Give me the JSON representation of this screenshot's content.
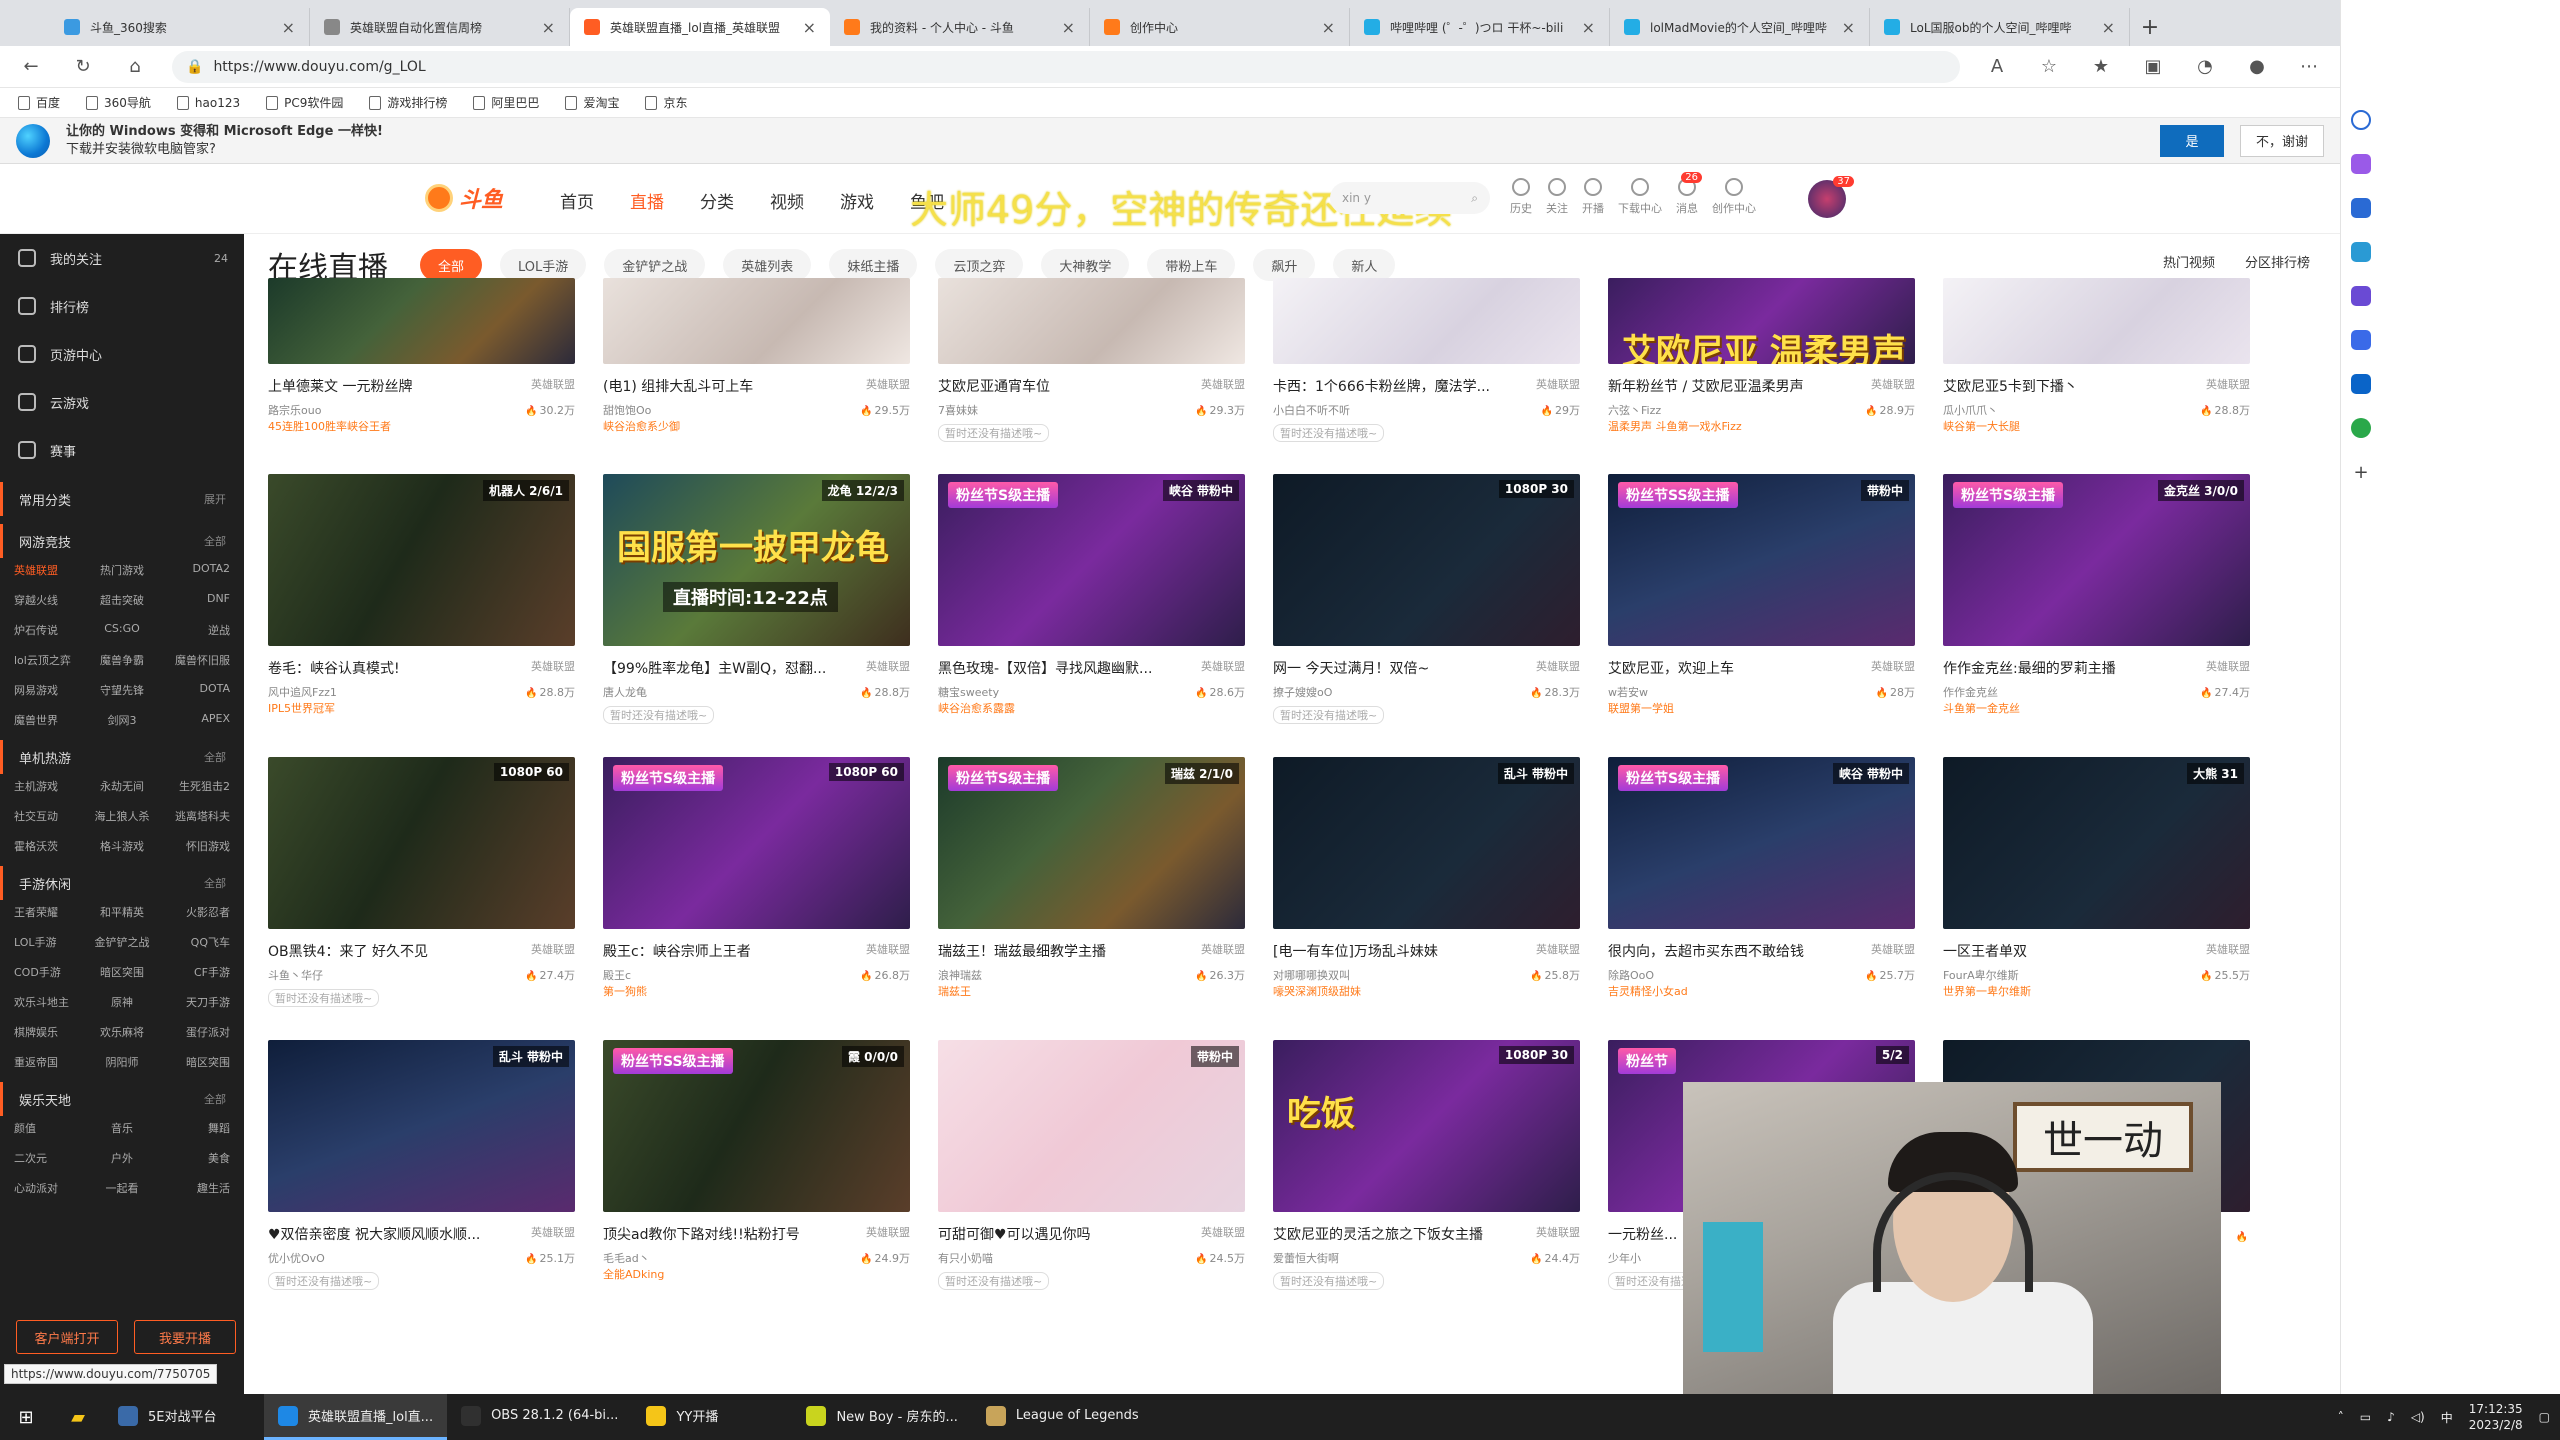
{
  "browser": {
    "tabs": [
      {
        "title": "斗鱼_360搜索",
        "color": "#3b9ae1",
        "active": false
      },
      {
        "title": "英雄联盟自动化置信周榜",
        "color": "#888888",
        "active": false
      },
      {
        "title": "英雄联盟直播_lol直播_英雄联盟",
        "color": "#ff5d23",
        "active": true
      },
      {
        "title": "我的资料 - 个人中心 - 斗鱼",
        "color": "#ff7a1a",
        "active": false
      },
      {
        "title": "创作中心",
        "color": "#ff7a1a",
        "active": false
      },
      {
        "title": "哔哩哔哩 (゜-゜)つロ 干杯~-bili",
        "color": "#23ade5",
        "active": false
      },
      {
        "title": "lolMadMovie的个人空间_哔哩哔",
        "color": "#23ade5",
        "active": false
      },
      {
        "title": "LoL国服ob的个人空间_哔哩哔",
        "color": "#23ade5",
        "active": false
      }
    ],
    "url": "https://www.douyu.com/g_LOL",
    "bookmarks": [
      "百度",
      "360导航",
      "hao123",
      "PC9软件园",
      "游戏排行榜",
      "阿里巴巴",
      "爱淘宝",
      "京东"
    ],
    "infobar": {
      "line1": "让你的 Windows 变得和 Microsoft Edge 一样快!",
      "line2": "下载并安装微软电脑管家?",
      "yes": "是",
      "no": "不，谢谢"
    }
  },
  "douyu": {
    "logo": "斗鱼",
    "nav": [
      "首页",
      "直播",
      "分类",
      "视频",
      "游戏",
      "鱼吧"
    ],
    "nav_active": "直播",
    "search_placeholder": "xin y",
    "tools": [
      {
        "label": "历史"
      },
      {
        "label": "关注"
      },
      {
        "label": "开播"
      },
      {
        "label": "下载中心"
      },
      {
        "label": "消息",
        "badge": "26"
      },
      {
        "label": "创作中心"
      }
    ],
    "avatar_badge": "37",
    "overlay_text": "大师49分，空神的传奇还在延续",
    "page_heading": "在线直播",
    "filters": [
      "全部",
      "LOL手游",
      "金铲铲之战",
      "英雄列表",
      "妹纸主播",
      "云顶之弈",
      "大神教学",
      "带粉上车",
      "飙升",
      "新人"
    ],
    "filters_right": [
      "热门视频",
      "分区排行榜"
    ],
    "sidebar": {
      "top": [
        "我的关注",
        "排行榜",
        "页游中心",
        "云游戏",
        "赛事"
      ],
      "follow_count": "24",
      "common": "常用分类",
      "common_expand": "展开",
      "sections": [
        {
          "title": "网游竞技",
          "items": [
            "英雄联盟",
            "热门游戏",
            "DOTA2",
            "穿越火线",
            "超击突破",
            "DNF",
            "炉石传说",
            "CS:GO",
            "逆战",
            "lol云顶之弈",
            "魔兽争霸",
            "魔兽怀旧服",
            "网易游戏",
            "守望先锋",
            "DOTA",
            "魔兽世界",
            "剑网3",
            "APEX"
          ]
        },
        {
          "title": "单机热游",
          "items": [
            "主机游戏",
            "永劫无间",
            "生死狙击2",
            "社交互动",
            "海上狼人杀",
            "逃离塔科夫",
            "霍格沃茨",
            "格斗游戏",
            "怀旧游戏"
          ]
        },
        {
          "title": "手游休闲",
          "items": [
            "王者荣耀",
            "和平精英",
            "火影忍者",
            "LOL手游",
            "金铲铲之战",
            "QQ飞车",
            "COD手游",
            "暗区突围",
            "CF手游",
            "欢乐斗地主",
            "原神",
            "天刀手游",
            "棋牌娱乐",
            "欢乐麻将",
            "蛋仔派对",
            "重返帝国",
            "阴阳师",
            "暗区突围"
          ]
        },
        {
          "title": "娱乐天地",
          "items": [
            "颜值",
            "音乐",
            "舞蹈",
            "二次元",
            "户外",
            "美食",
            "心动派对",
            "一起看",
            "趣生活"
          ]
        }
      ],
      "all_label": "全部",
      "bottom": [
        "客户端打开",
        "我要开播"
      ]
    },
    "cards": [
      {
        "title": "上单德莱文 一元粉丝牌",
        "cat": "英雄联盟",
        "anchor": "路宗乐ouo",
        "hot": "30.2万",
        "tag": "45连胜100胜率峡谷王者",
        "bg": "bg-game1"
      },
      {
        "title": "(电1) 组排大乱斗可上车",
        "cat": "英雄联盟",
        "anchor": "甜饱饱Oo",
        "hot": "29.5万",
        "tag": "峡谷治愈系少御",
        "bg": "bg-girl1"
      },
      {
        "title": "艾欧尼亚通宵车位",
        "cat": "英雄联盟",
        "anchor": "7喜妹妹",
        "hot": "29.3万",
        "tag": "暂时还没有描述哦~",
        "gray": true,
        "bg": "bg-girl1"
      },
      {
        "title": "卡西：1个666卡粉丝牌，魔法学...",
        "cat": "英雄联盟",
        "anchor": "小白白不听不听",
        "hot": "29万",
        "tag": "暂时还没有描述哦~",
        "gray": true,
        "bg": "bg-girl2"
      },
      {
        "title": "新年粉丝节 / 艾欧尼亚温柔男声",
        "cat": "英雄联盟",
        "anchor": "六弦丶Fizz",
        "hot": "28.9万",
        "tag": "温柔男声 斗鱼第一戏水Fizz",
        "bg": "bg-purple",
        "banner": "艾欧尼亚 温柔男声"
      },
      {
        "title": "艾欧尼亚5卡到下播丶",
        "cat": "英雄联盟",
        "anchor": "瓜小爪爪丶",
        "hot": "28.8万",
        "tag": "峡谷第一大长腿",
        "bg": "bg-girl2"
      },
      {
        "title": "卷毛：峡谷认真模式!",
        "cat": "英雄联盟",
        "anchor": "风中追风Fzz1",
        "hot": "28.8万",
        "tag": "IPL5世界冠军",
        "bg": "bg-game3",
        "corner": "机器人 2/6/1"
      },
      {
        "title": "【99%胜率龙龟】主W副Q，怼翻...",
        "cat": "英雄联盟",
        "anchor": "唐人龙龟",
        "hot": "28.8万",
        "tag": "暂时还没有描述哦~",
        "gray": true,
        "bg": "bg-dragon",
        "corner": "龙龟 12/2/3",
        "banner": "国服第一披甲龙龟",
        "sub": "直播时间:12-22点"
      },
      {
        "title": "黑色玫瑰-【双倍】寻找风趣幽默...",
        "cat": "英雄联盟",
        "anchor": "糖宝sweety",
        "hot": "28.6万",
        "tag": "峡谷治愈系露露",
        "bg": "bg-purple",
        "corner": "峡谷 带粉中",
        "fan": "粉丝节S级主播"
      },
      {
        "title": "网一 今天过满月！双倍~",
        "cat": "英雄联盟",
        "anchor": "撩子嫂嫂oO",
        "hot": "28.3万",
        "tag": "暂时还没有描述哦~",
        "gray": true,
        "bg": "bg-dark",
        "corner": "1080P 30"
      },
      {
        "title": "艾欧尼亚，欢迎上车",
        "cat": "英雄联盟",
        "anchor": "w若安w",
        "hot": "28万",
        "tag": "联盟第一学姐",
        "bg": "bg-game2",
        "corner": "带粉中",
        "fan": "粉丝节SS级主播"
      },
      {
        "title": "作作金克丝:最细的罗莉主播",
        "cat": "英雄联盟",
        "anchor": "作作金克丝",
        "hot": "27.4万",
        "tag": "斗鱼第一金克丝",
        "bg": "bg-purple",
        "corner": "金克丝 3/0/0",
        "fan": "粉丝节S级主播"
      },
      {
        "title": "OB黑铁4：来了 好久不见",
        "cat": "英雄联盟",
        "anchor": "斗鱼丶华仔",
        "hot": "27.4万",
        "tag": "暂时还没有描述哦~",
        "gray": true,
        "bg": "bg-game3",
        "corner": "1080P 60"
      },
      {
        "title": "殿王c：峡谷宗师上王者",
        "cat": "英雄联盟",
        "anchor": "殿王c",
        "hot": "26.8万",
        "tag": "第一狗熊",
        "bg": "bg-purple",
        "corner": "1080P 60",
        "fan": "粉丝节S级主播"
      },
      {
        "title": "瑞兹王！瑞兹最细教学主播",
        "cat": "英雄联盟",
        "anchor": "浪神瑞兹",
        "hot": "26.3万",
        "tag": "瑞兹王",
        "bg": "bg-game1",
        "corner": "瑞兹 2/1/0",
        "fan": "粉丝节S级主播"
      },
      {
        "title": "[电一有车位]万场乱斗妹妹",
        "cat": "英雄联盟",
        "anchor": "对哪哪哪换双叫",
        "hot": "25.8万",
        "tag": "嚎哭深渊顶级甜妹",
        "bg": "bg-dark",
        "corner": "乱斗 带粉中"
      },
      {
        "title": "很内向，去超市买东西不敢给钱",
        "cat": "英雄联盟",
        "anchor": "除路OoO",
        "hot": "25.7万",
        "tag": "吉灵精怪小女ad",
        "bg": "bg-game2",
        "corner": "峡谷 带粉中",
        "fan": "粉丝节S级主播"
      },
      {
        "title": "一区王者单双",
        "cat": "英雄联盟",
        "anchor": "FourA卑尔维斯",
        "hot": "25.5万",
        "tag": "世界第一卑尔维斯",
        "bg": "bg-dark",
        "corner": "大熊 31"
      },
      {
        "title": "♥双倍亲密度 祝大家顺风顺水顺...",
        "cat": "英雄联盟",
        "anchor": "优小优OvO",
        "hot": "25.1万",
        "tag": "暂时还没有描述哦~",
        "gray": true,
        "bg": "bg-game2",
        "corner": "乱斗 带粉中"
      },
      {
        "title": "顶尖ad教你下路对线!!粘粉打号",
        "cat": "英雄联盟",
        "anchor": "毛毛ad丶",
        "hot": "24.9万",
        "tag": "全能ADking",
        "bg": "bg-game3",
        "corner": "霞 0/0/0",
        "fan": "粉丝节SS级主播"
      },
      {
        "title": "可甜可御♥可以遇见你吗",
        "cat": "英雄联盟",
        "anchor": "有只小奶喵",
        "hot": "24.5万",
        "tag": "暂时还没有描述哦~",
        "gray": true,
        "bg": "bg-pink",
        "corner": "带粉中"
      },
      {
        "title": "艾欧尼亚的灵活之旅之下饭女主播",
        "cat": "英雄联盟",
        "anchor": "爱蕾恒大街啊",
        "hot": "24.4万",
        "tag": "暂时还没有描述哦~",
        "gray": true,
        "bg": "bg-purple",
        "corner": "1080P 30",
        "banner": "吃饭"
      },
      {
        "title": "一元粉丝...",
        "cat": "英雄联盟",
        "anchor": "少年小",
        "hot": "24万",
        "tag": "暂时还没有描述哦~",
        "gray": true,
        "bg": "bg-purple",
        "corner": "5/2",
        "fan": "粉丝节"
      },
      {
        "title": "",
        "cat": "",
        "anchor": "",
        "hot": "",
        "tag": "",
        "bg": "bg-dark"
      }
    ]
  },
  "webcam_text": "世一动",
  "status_url": "https://www.douyu.com/7750705",
  "taskbar": {
    "items": [
      {
        "label": "5E对战平台",
        "color": "#3a6aa8"
      },
      {
        "label": "英雄联盟直播_lol直...",
        "color": "#1e88e5",
        "active": true
      },
      {
        "label": "OBS 28.1.2 (64-bi...",
        "color": "#303030"
      },
      {
        "label": "YY开播",
        "color": "#f5c518"
      },
      {
        "label": "New Boy - 房东的...",
        "color": "#c9d41e"
      },
      {
        "label": "League of Legends",
        "color": "#c8a45a"
      }
    ],
    "time": "17:12:35",
    "date": "2023/2/8",
    "ime": "中"
  }
}
